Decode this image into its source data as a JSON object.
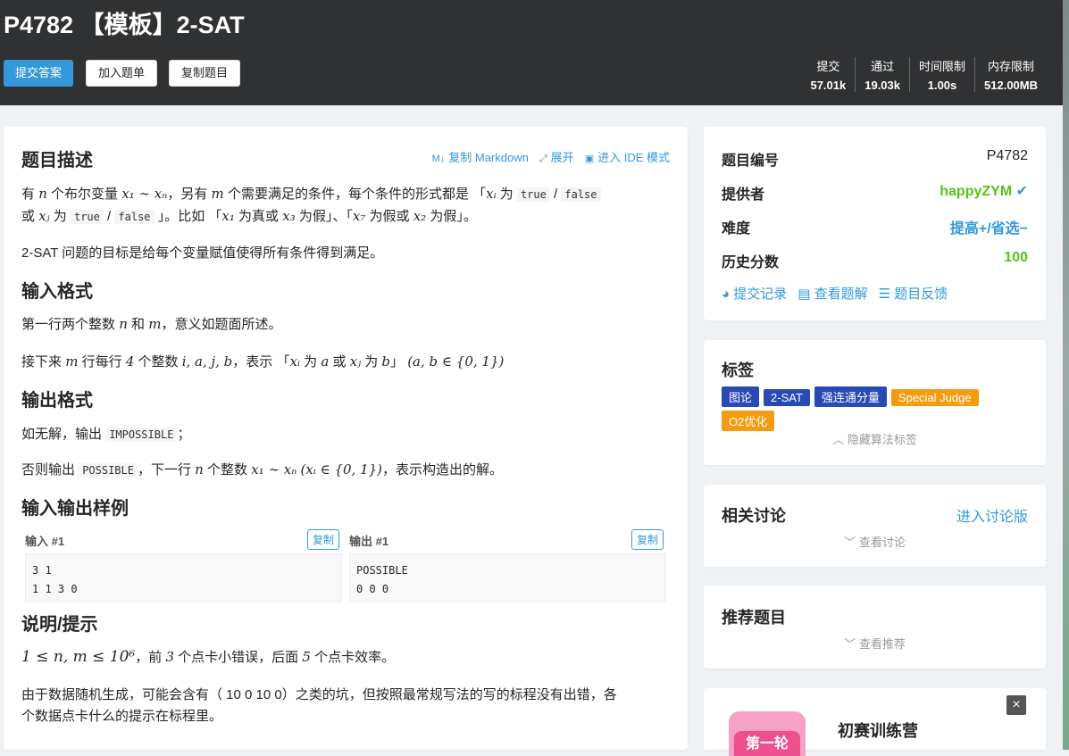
{
  "problem": {
    "title": "P4782 【模板】2-SAT",
    "buttons": {
      "submit": "提交答案",
      "add": "加入题单",
      "copy": "复制题目"
    },
    "stats": [
      {
        "label": "提交",
        "value": "57.01k"
      },
      {
        "label": "通过",
        "value": "19.03k"
      },
      {
        "label": "时间限制",
        "value": "1.00s"
      },
      {
        "label": "内存限制",
        "value": "512.00MB"
      }
    ]
  },
  "content": {
    "desc_heading": "题目描述",
    "actions": {
      "copy_md": "复制 Markdown",
      "expand": "展开",
      "ide": "进入 IDE 模式"
    },
    "desc_p1_a": "有",
    "desc_p1_b": "个布尔变量",
    "desc_p1_c": "，另有",
    "desc_p1_d": "个需要满足的条件，每个条件的形式都是 「",
    "desc_p1_e": "为",
    "desc_p1_true": "true",
    "desc_p1_slash": "/",
    "desc_p1_false": "false",
    "desc_p2_a": "或",
    "desc_p2_b": "为",
    "desc_p2_c": "」。比如 「",
    "desc_p2_d": "为真或",
    "desc_p2_e": "为假」、「",
    "desc_p2_f": "为假或",
    "desc_p2_g": "为假」。",
    "desc_p3": "2-SAT 问题的目标是给每个变量赋值使得所有条件得到满足。",
    "input_heading": "输入格式",
    "input_p1_a": "第一行两个整数",
    "input_p1_b": "和",
    "input_p1_c": "，意义如题面所述。",
    "input_p2_a": "接下来",
    "input_p2_b": "行每行",
    "input_p2_c": "个整数",
    "input_p2_d": "，表示 「",
    "input_p2_e": "为",
    "input_p2_f": "或",
    "input_p2_g": "为",
    "input_p2_h": "」",
    "output_heading": "输出格式",
    "output_p1_a": "如无解，输出",
    "output_p1_code": "IMPOSSIBLE",
    "output_p1_b": "；",
    "output_p2_a": "否则输出",
    "output_p2_code": "POSSIBLE",
    "output_p2_b": "，下一行",
    "output_p2_c": "个整数",
    "output_p2_d": "，表示构造出的解。",
    "sample_heading": "输入输出样例",
    "sample_in_label": "输入 #1",
    "sample_out_label": "输出 #1",
    "copy_label": "复制",
    "sample_in_line1": "3 1",
    "sample_in_line2": "1 1 3 0",
    "sample_out_line1": "POSSIBLE",
    "sample_out_line2": "0 0 0",
    "hint_heading": "说明/提示",
    "hint_p1_a": "，前",
    "hint_p1_b": "个点卡小错误，后面",
    "hint_p1_c": "个点卡效率。",
    "hint_p2_l1": "由于数据随机生成，可能会含有（ 10 0 10 0）之类的坑，但按照最常规写法的写的标程没有出错，各",
    "hint_p2_l2": "个数据点卡什么的提示在标程里。"
  },
  "math": {
    "n": "n",
    "m": "m",
    "x1_xn": "x₁ ∼ xₙ",
    "xi": "xᵢ",
    "xj": "xⱼ",
    "x1": "x₁",
    "x3": "x₃",
    "x7": "x₇",
    "x2": "x₂",
    "four": "4",
    "ijab": "i, a, j, b",
    "a": "a",
    "b": "b",
    "ab_set": "(a, b ∈ {0, 1})",
    "xi_set": "(xᵢ ∈ {0, 1})",
    "bound": "1 ≤ n, m ≤ 10⁶",
    "three": "3",
    "five": "5"
  },
  "sidebar": {
    "id_label": "题目编号",
    "id_value": "P4782",
    "provider_label": "提供者",
    "provider_value": "happyZYM",
    "difficulty_label": "难度",
    "difficulty_value": "提高+/省选−",
    "history_label": "历史分数",
    "history_value": "100",
    "link_records": "提交记录",
    "link_solutions": "查看题解",
    "link_feedback": "题目反馈",
    "tags_heading": "标签",
    "tags": [
      {
        "label": "图论",
        "color": "#2949b4"
      },
      {
        "label": "2-SAT",
        "color": "#2949b4"
      },
      {
        "label": "强连通分量",
        "color": "#2949b4"
      },
      {
        "label": "Special Judge",
        "color": "#f39c11"
      },
      {
        "label": "O2优化",
        "color": "#f39c11"
      }
    ],
    "hide_tags": "隐藏算法标签",
    "discuss_heading": "相关讨论",
    "discuss_link": "进入讨论版",
    "view_discuss": "查看讨论",
    "recommend_heading": "推荐题目",
    "view_recommend": "查看推荐",
    "promo_title": "初赛训练营",
    "promo_badge": "第一轮",
    "close": "×"
  },
  "colors": {
    "accent": "#3498db",
    "header": "#303133",
    "success": "#52c41a",
    "provider": "#52c41a"
  }
}
